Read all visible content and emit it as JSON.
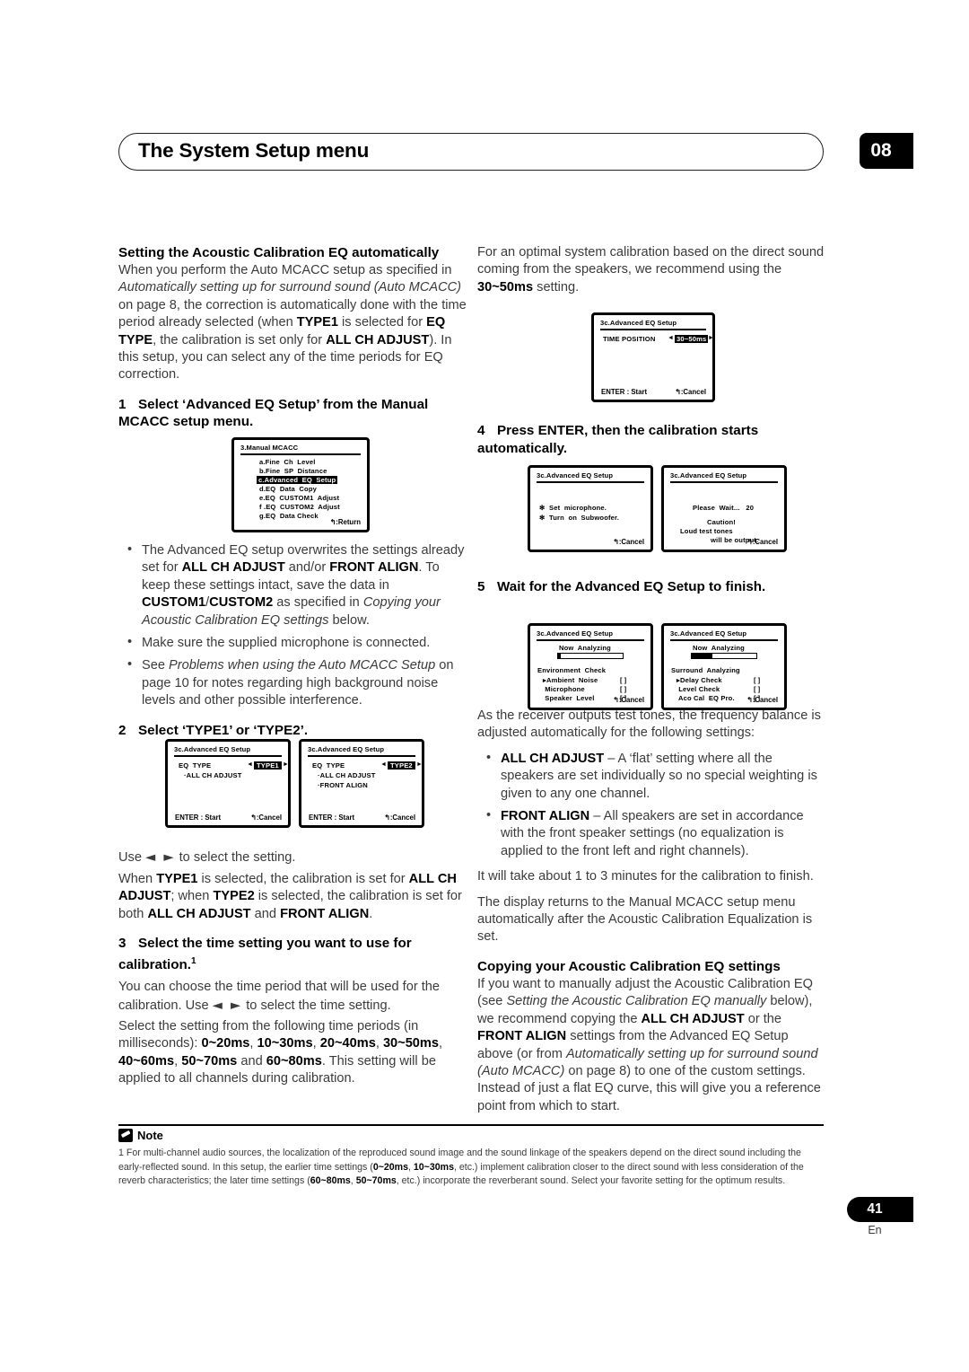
{
  "header": {
    "title": "The System Setup menu",
    "chapter": "08"
  },
  "left": {
    "section_heading": "Setting the Acoustic Calibration EQ automatically",
    "intro_1": "When you perform the Auto MCACC setup as specified in ",
    "intro_1_italic": "Automatically setting up for surround sound (Auto MCACC)",
    "intro_2": " on page 8, the correction is automatically done with the time period already selected (when ",
    "intro_b1": "TYPE1",
    "intro_3": " is selected for ",
    "intro_b2": "EQ TYPE",
    "intro_4": ", the calibration is set only for ",
    "intro_b3": "ALL CH ADJUST",
    "intro_5": "). In this setup, you can select any of the time periods for EQ correction.",
    "step1_num": "1",
    "step1_text": "Select ‘Advanced EQ Setup’ from the Manual MCACC setup menu.",
    "bullet1_a": "The Advanced EQ setup overwrites the settings already set for ",
    "bullet1_b1": "ALL CH ADJUST",
    "bullet1_b": " and/or ",
    "bullet1_b2": "FRONT ALIGN",
    "bullet1_c": ". To keep these settings intact, save the data in ",
    "bullet1_b3": "CUSTOM1",
    "bullet1_d": "/",
    "bullet1_b4": "CUSTOM2",
    "bullet1_e": " as specified in ",
    "bullet1_i": "Copying your Acoustic Calibration EQ settings",
    "bullet1_f": " below.",
    "bullet2": "Make sure the supplied microphone is connected.",
    "bullet3_a": "See ",
    "bullet3_i": "Problems when using the Auto MCACC Setup",
    "bullet3_b": " on page 10 for notes regarding high background noise levels and other possible interference.",
    "step2_num": "2",
    "step2_text": "Select ‘TYPE1’ or ‘TYPE2’.",
    "use_arrows_1_pre": "Use ",
    "use_arrows_1_keys": "◄ ►",
    "use_arrows_1_post": " to select the setting.",
    "type_expl_a": "When ",
    "type_expl_b1": "TYPE1",
    "type_expl_b": " is selected, the calibration is set for ",
    "type_expl_b2": "ALL CH ADJUST",
    "type_expl_c": "; when ",
    "type_expl_b3": "TYPE2",
    "type_expl_d": " is selected, the calibration is set for both ",
    "type_expl_b4": "ALL CH ADJUST",
    "type_expl_e": " and ",
    "type_expl_b5": "FRONT ALIGN",
    "type_expl_f": ".",
    "step3_num": "3",
    "step3_text": "Select the time setting you want to use for calibration.",
    "step3_footmark": "1",
    "step3_p1_a": "You can choose the time period that will be used for the calibration. Use ",
    "step3_p1_keys": "◄ ►",
    "step3_p1_b": " to select the time setting.",
    "step3_p2_a": "Select the setting from the following time periods (in milliseconds): ",
    "times": [
      "0~20ms",
      "10~30ms",
      "20~40ms",
      "30~50ms",
      "40~60ms",
      "50~70ms",
      "60~80ms"
    ],
    "step3_p2_b": ". This setting will be applied to all channels during calibration."
  },
  "right": {
    "intro_a": "For an optimal system calibration based on the direct sound coming from the speakers, we recommend using the ",
    "intro_b": "30~50ms",
    "intro_c": " setting.",
    "step4_num": "4",
    "step4_text": "Press ENTER, then the calibration starts automatically.",
    "step5_num": "5",
    "step5_text": "Wait for the Advanced EQ Setup to finish.",
    "p_tones": "As the receiver outputs test tones, the frequency balance is adjusted automatically for the following settings:",
    "bullet_allch_b": "ALL CH ADJUST",
    "bullet_allch_t": " – A ‘flat’ setting where all the speakers are set individually so no special weighting is given to any one channel.",
    "bullet_front_b": "FRONT ALIGN",
    "bullet_front_t": " – All speakers are set in accordance with the front speaker settings (no equalization is applied to the front left and right channels).",
    "p_duration": "It will take about 1 to 3 minutes for the calibration to finish.",
    "p_return": "The display returns to the Manual MCACC setup menu automatically after the Acoustic Calibration Equalization is set.",
    "copy_heading": "Copying your Acoustic Calibration EQ settings",
    "copy_a": "If you want to manually adjust the Acoustic Calibration EQ (see ",
    "copy_i1": "Setting the Acoustic Calibration EQ manually",
    "copy_b": " below), we recommend copying the ",
    "copy_b1": "ALL CH ADJUST",
    "copy_c": " or the ",
    "copy_b2": "FRONT ALIGN",
    "copy_d": " settings from the Advanced EQ Setup above (or from ",
    "copy_i2": "Automatically setting up for surround sound (Auto MCACC)",
    "copy_e": " on page 8) to one of the custom settings. Instead of just a flat EQ curve, this will give you a reference point from which to start."
  },
  "lcd": {
    "manual_mcacc": {
      "title": "3.Manual  MCACC",
      "items": [
        "a.Fine  Ch  Level",
        "b.Fine  SP  Distance",
        "c.Advanced  EQ  Setup",
        "d.EQ  Data  Copy",
        "e.EQ  CUSTOM1  Adjust",
        "f .EQ  CUSTOM2  Adjust",
        "g.EQ  Data Check"
      ],
      "selected_index": 2,
      "footer_right": "↰:Return"
    },
    "type1": {
      "title": "3c.Advanced EQ Setup",
      "label": "EQ  TYPE",
      "value": "TYPE1",
      "sub": [
        "·ALL CH ADJUST"
      ],
      "footer_left": "ENTER : Start",
      "footer_right": "↰:Cancel"
    },
    "type2": {
      "title": "3c.Advanced EQ Setup",
      "label": "EQ  TYPE",
      "value": "TYPE2",
      "sub": [
        "·ALL CH ADJUST",
        "·FRONT ALIGN"
      ],
      "footer_left": "ENTER : Start",
      "footer_right": "↰:Cancel"
    },
    "time_position": {
      "title": "3c.Advanced EQ Setup",
      "label": "TIME POSITION",
      "value": "30~50ms",
      "footer_left": "ENTER : Start",
      "footer_right": "↰:Cancel"
    },
    "set_mic": {
      "title": "3c.Advanced EQ Setup",
      "line1": "✻  Set  microphone.",
      "line2": "✻  Turn  on  Subwoofer.",
      "footer_right": "↰:Cancel"
    },
    "please_wait": {
      "title": "3c.Advanced EQ Setup",
      "line1": "Please  Wait...   20",
      "line2": "Caution!",
      "line3": "Loud test tones",
      "line4": "will be output.",
      "footer_right": "↰:Cancel"
    },
    "env_check": {
      "title": "3c.Advanced EQ Setup",
      "now": "Now  Analyzing",
      "progress": 4,
      "group": "Environment  Check",
      "rows": [
        "▸Ambient  Noise",
        " Microphone",
        " Speaker  Level"
      ],
      "brackets": "[      ]",
      "footer_right": "↰:Cancel"
    },
    "surround": {
      "title": "3c.Advanced EQ Setup",
      "now": "Now  Analyzing",
      "progress": 32,
      "group": "Surround  Analyzing",
      "rows": [
        "▸Delay Check",
        " Level Check",
        " Aco Cal  EQ Pro."
      ],
      "brackets": "[      ]",
      "footer_right": "↰:Cancel"
    }
  },
  "footer": {
    "note_label": "Note",
    "note_marker": "1",
    "note_a": "For multi-channel audio sources, the localization of the reproduced sound image and the sound linkage of the speakers depend on the direct sound including the early-reflected sound. In this setup, the earlier time settings (",
    "note_b1": "0~20ms",
    "note_sep1": ", ",
    "note_b2": "10~30ms",
    "note_c": ", etc.) implement calibration closer to the direct sound with less consideration of the reverb characteristics; the later time settings (",
    "note_b3": "60~80ms",
    "note_sep2": ", ",
    "note_b4": "50~70ms",
    "note_d": ", etc.) incorporate the reverberant sound. Select your favorite setting for the optimum results.",
    "page_number": "41",
    "language": "En"
  }
}
